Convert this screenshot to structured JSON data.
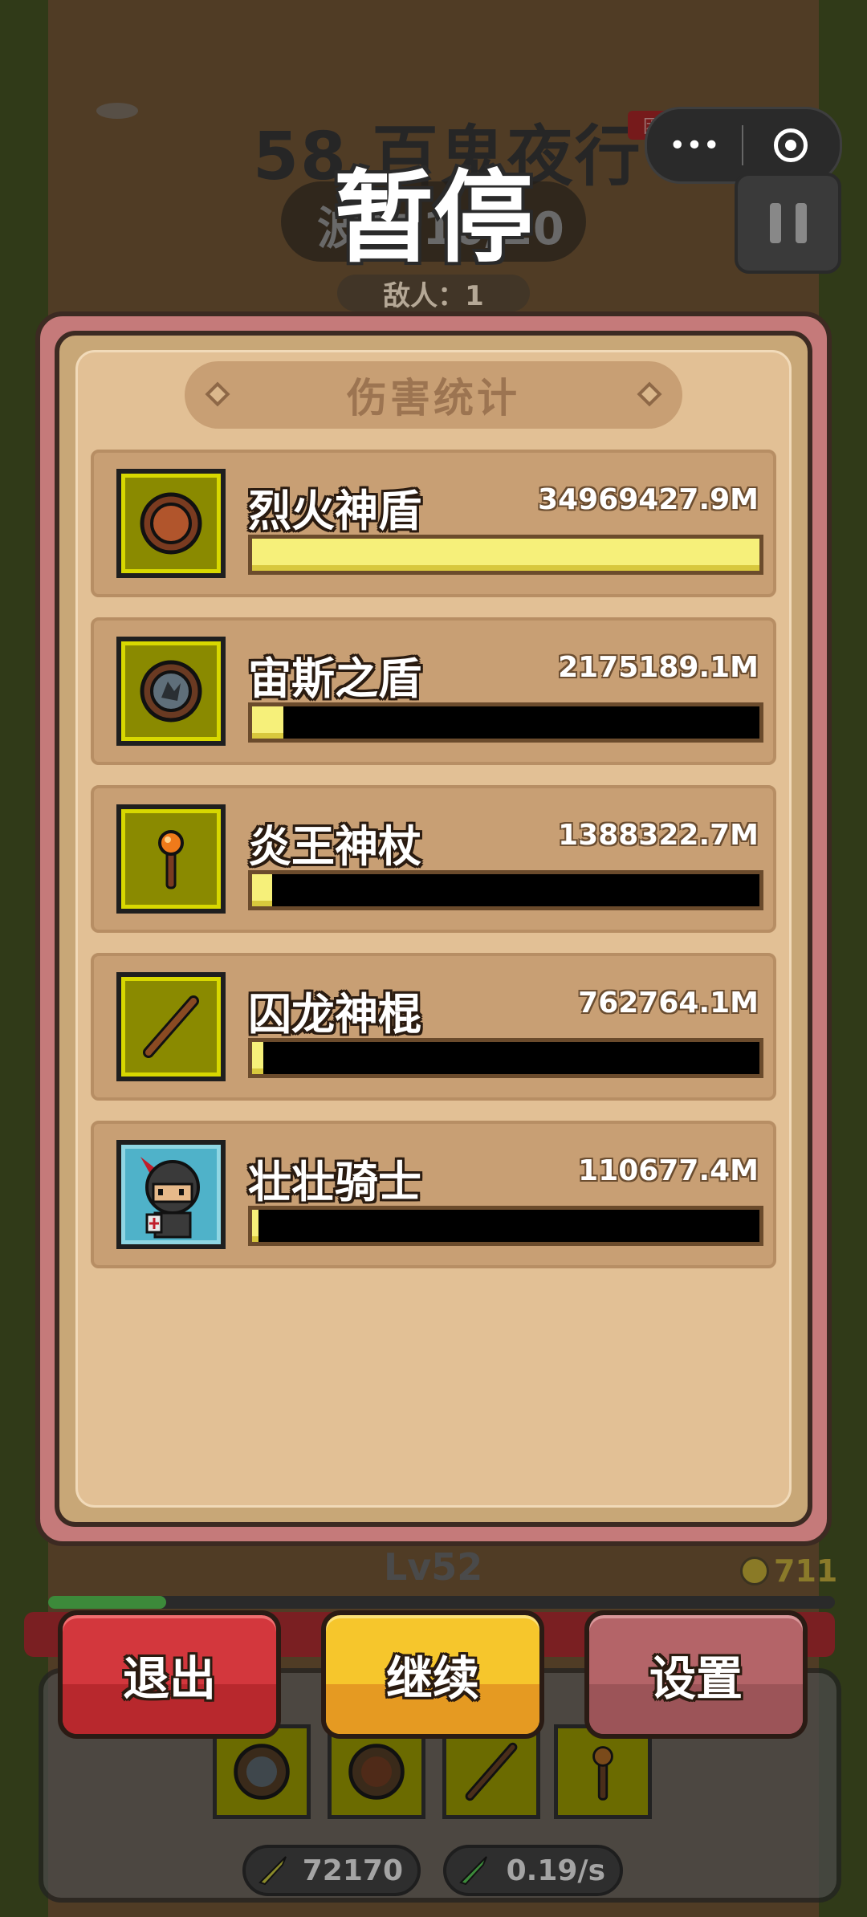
{
  "level": {
    "title": "58 百鬼夜行",
    "difficulty": "困难"
  },
  "wave": {
    "text": "波数 10/20"
  },
  "pause_title": "暂停",
  "enemies": {
    "text": "敌人：1"
  },
  "capsule": {
    "more_icon": "more-dots-icon",
    "close_icon": "target-icon"
  },
  "panel": {
    "title": "伤害统计",
    "rows": [
      {
        "name": "烈火神盾",
        "value": "34969427.9M",
        "fraction": 1.0,
        "icon": "fire-shield-icon"
      },
      {
        "name": "宙斯之盾",
        "value": "2175189.1M",
        "fraction": 0.062,
        "icon": "zeus-shield-icon"
      },
      {
        "name": "炎王神杖",
        "value": "1388322.7M",
        "fraction": 0.04,
        "icon": "flame-staff-icon"
      },
      {
        "name": "囚龙神棍",
        "value": "762764.1M",
        "fraction": 0.022,
        "icon": "dragon-staff-icon"
      },
      {
        "name": "壮壮骑士",
        "value": "110677.4M",
        "fraction": 0.003,
        "icon": "knight-avatar-icon"
      }
    ]
  },
  "player": {
    "level": "Lv52",
    "coins": "711",
    "xp_fraction": 0.15
  },
  "buttons": {
    "exit": "退出",
    "continue": "继续",
    "settings": "设置"
  },
  "stats": {
    "attack": "72170",
    "speed": "0.19/s"
  },
  "colors": {
    "bar_fill": "#f6f07a",
    "exit": "#d3373d",
    "continue": "#f6c62c",
    "settings": "#b46468"
  }
}
